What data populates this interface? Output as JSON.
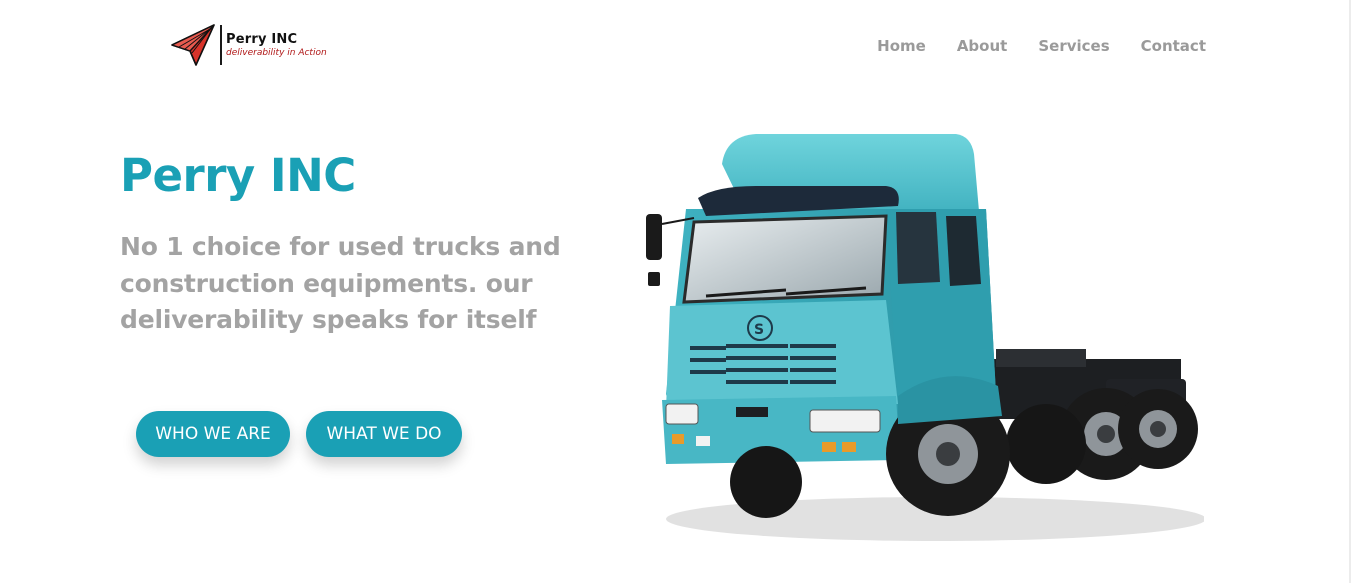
{
  "brand": {
    "name": "Perry INC",
    "tagline": "deliverability in Action",
    "accent_color": "#1aa0b5",
    "logo_color": "#d8332a"
  },
  "nav": {
    "items": [
      {
        "label": "Home"
      },
      {
        "label": "About"
      },
      {
        "label": "Services"
      },
      {
        "label": "Contact"
      }
    ]
  },
  "hero": {
    "title": "Perry INC",
    "subtitle": "No 1 choice for used trucks and construction equipments. our deliverability speaks for itself",
    "buttons": {
      "who": "WHO WE ARE",
      "what": "WHAT WE DO"
    },
    "image_subject": "turquoise semi-truck tractor"
  }
}
